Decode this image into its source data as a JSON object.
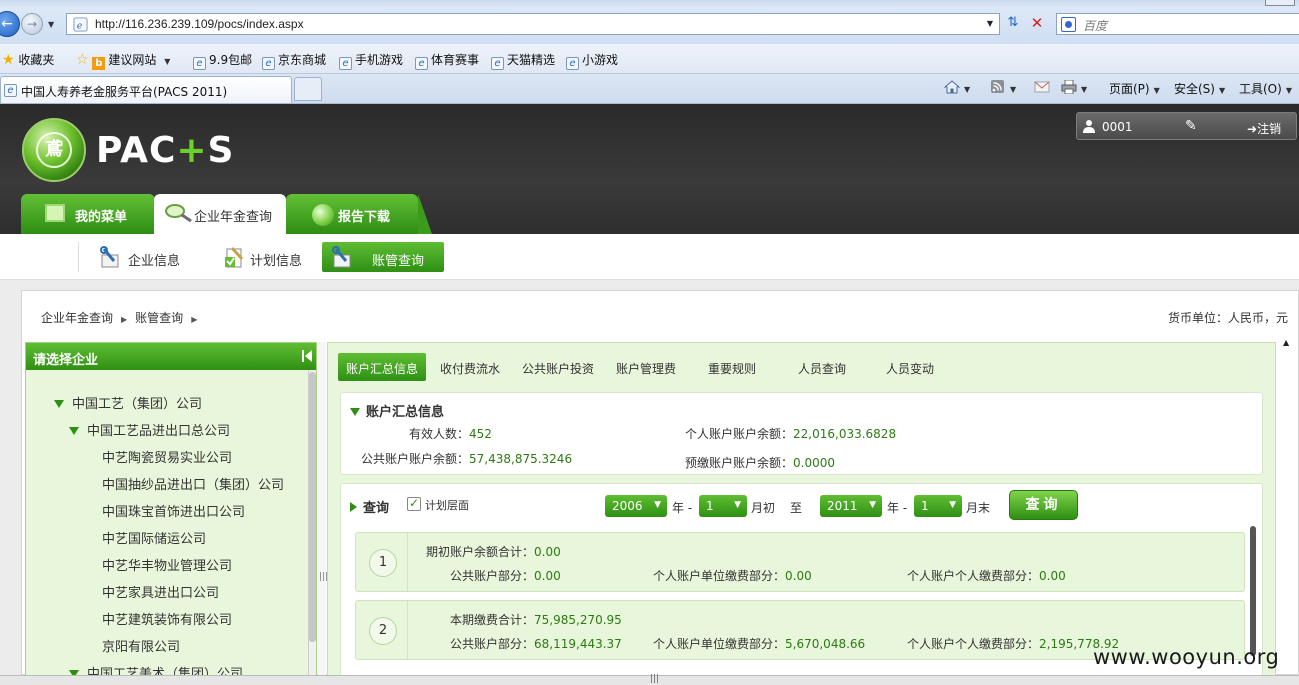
{
  "browser": {
    "url": "http://116.236.239.109/pocs/index.aspx",
    "search_placeholder": "百度",
    "favorites_label": "收藏夹",
    "favorites": [
      "建议网站",
      "9.9包邮",
      "京东商城",
      "手机游戏",
      "体育赛事",
      "天猫精选",
      "小游戏"
    ],
    "tab_title": "中国人寿养老金服务平台(PACS 2011)",
    "commands": {
      "page": "页面(P)",
      "safety": "安全(S)",
      "tools": "工具(O)"
    }
  },
  "header": {
    "logo_text_left": "PAC",
    "logo_text_plus": "+",
    "logo_text_right": "S",
    "logo_glyph": "鳶",
    "user_id": "0001",
    "logout": "注销"
  },
  "main_tabs": [
    "我的菜单",
    "企业年金查询",
    "报告下载"
  ],
  "sub_tabs": [
    "企业信息",
    "计划信息",
    "账管查询"
  ],
  "breadcrumb": [
    "企业年金查询",
    "账管查询"
  ],
  "currency": "货币单位：人民币，元",
  "tree": {
    "title": "请选择企业",
    "nodes": [
      "中国工艺（集团）公司",
      "中国工艺品进出口总公司",
      "中艺陶瓷贸易实业公司",
      "中国抽纱品进出口（集团）公司",
      "中国珠宝首饰进出口公司",
      "中艺国际储运公司",
      "中艺华丰物业管理公司",
      "中艺家具进出口公司",
      "中艺建筑装饰有限公司",
      "京阳有限公司",
      "中国工艺美术（集团）公司"
    ]
  },
  "right_tabs": [
    "账户汇总信息",
    "收付费流水",
    "公共账户投资",
    "账户管理费",
    "重要规则",
    "人员查询",
    "人员变动"
  ],
  "summary": {
    "title": "账户汇总信息",
    "valid_count_label": "有效人数：",
    "valid_count": "452",
    "personal_balance_label": "个人账户账户余额：",
    "personal_balance": "22,016,033.6828",
    "public_balance_label": "公共账户账户余额：",
    "public_balance": "57,438,875.3246",
    "prepaid_balance_label": "预缴账户账户余额：",
    "prepaid_balance": "0.0000"
  },
  "query": {
    "title": "查询",
    "plan_level": "计划层面",
    "from_year": "2006",
    "from_month": "1",
    "to_year": "2011",
    "to_month": "1",
    "year_sep": "年 -",
    "month_begin": "月初",
    "to": "至",
    "month_end": "月末",
    "button": "查询"
  },
  "rows": [
    {
      "num": "1",
      "total_label": "期初账户余额合计：",
      "total": "0.00",
      "public_label": "公共账户部分：",
      "public": "0.00",
      "unit_label": "个人账户单位缴费部分：",
      "unit": "0.00",
      "personal_label": "个人账户个人缴费部分：",
      "personal": "0.00"
    },
    {
      "num": "2",
      "total_label": "本期缴费合计：",
      "total": "75,985,270.95",
      "public_label": "公共账户部分：",
      "public": "68,119,443.37",
      "unit_label": "个人账户单位缴费部分：",
      "unit": "5,670,048.66",
      "personal_label": "个人账户个人缴费部分：",
      "personal": "2,195,778.92"
    }
  ],
  "watermark": "www.wooyun.org"
}
